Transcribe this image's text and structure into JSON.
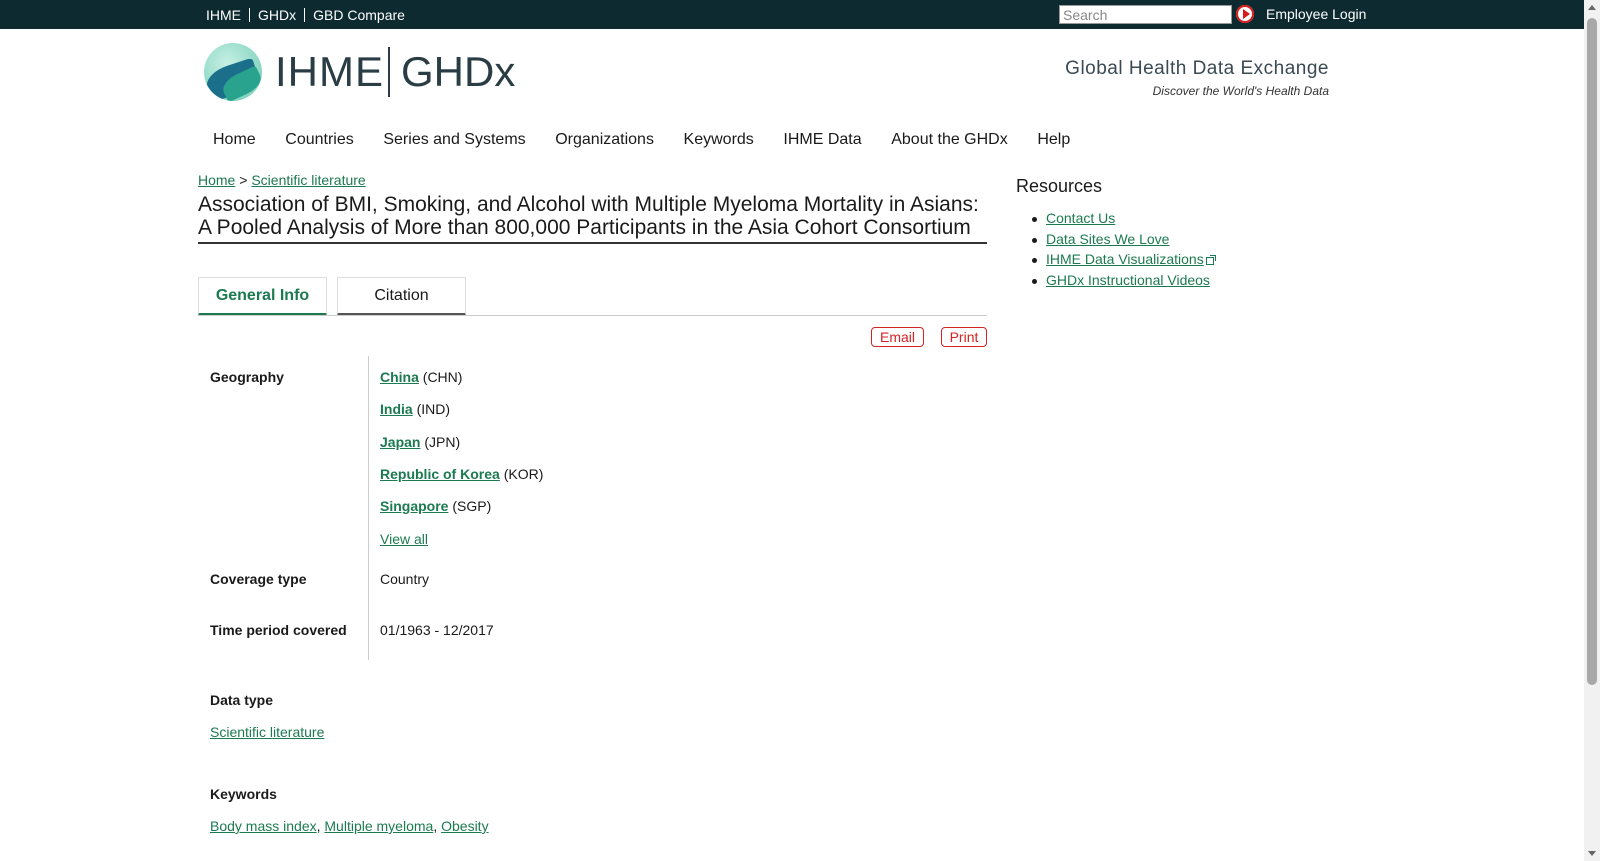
{
  "topbar": {
    "links": [
      "IHME",
      "GHDx",
      "GBD Compare"
    ],
    "search_placeholder": "Search",
    "employee_login": "Employee Login"
  },
  "header": {
    "logo_left": "IHME",
    "logo_right": "GHDx",
    "site_title": "Global Health Data Exchange",
    "site_slogan": "Discover the World's Health Data"
  },
  "nav": {
    "items": [
      "Home",
      "Countries",
      "Series and Systems",
      "Organizations",
      "Keywords",
      "IHME Data",
      "About the GHDx",
      "Help"
    ]
  },
  "breadcrumb": {
    "home": "Home",
    "separator": ">",
    "section": "Scientific literature"
  },
  "page": {
    "title": "Association of BMI, Smoking, and Alcohol with Multiple Myeloma Mortality in Asians: A Pooled Analysis of More than 800,000 Participants in the Asia Cohort Consortium"
  },
  "tabs": {
    "general": "General Info",
    "citation": "Citation"
  },
  "actions": {
    "email": "Email",
    "print": "Print"
  },
  "info": {
    "geography_label": "Geography",
    "geography": [
      {
        "name": "China",
        "code": "(CHN)"
      },
      {
        "name": "India",
        "code": "(IND)"
      },
      {
        "name": "Japan",
        "code": "(JPN)"
      },
      {
        "name": "Republic of Korea",
        "code": "(KOR)"
      },
      {
        "name": "Singapore",
        "code": "(SGP)"
      }
    ],
    "view_all": "View all",
    "coverage_label": "Coverage type",
    "coverage_value": "Country",
    "time_label": "Time period covered",
    "time_value": "01/1963 - 12/2017",
    "data_type_label": "Data type",
    "data_type_value": "Scientific literature",
    "keywords_label": "Keywords",
    "keywords": [
      "Body mass index",
      "Multiple myeloma",
      "Obesity"
    ],
    "keyword_separator": ","
  },
  "sidebar": {
    "title": "Resources",
    "links": [
      "Contact Us",
      "Data Sites We Love",
      "IHME Data Visualizations",
      "GHDx Instructional Videos"
    ]
  },
  "colors": {
    "topbar_bg": "#0c2a2f",
    "link_green": "#1c7a50",
    "action_red": "#d32323"
  }
}
